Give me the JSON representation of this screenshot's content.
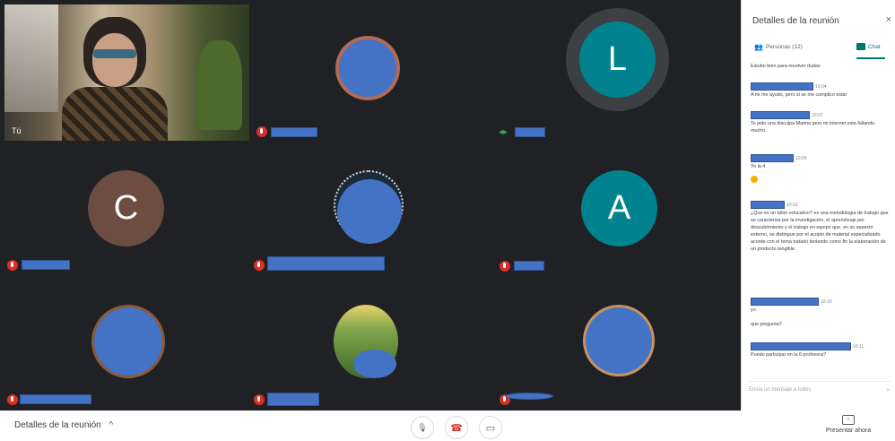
{
  "self_tile": {
    "label": "Tú"
  },
  "letters": {
    "l": "L",
    "c": "C",
    "a": "A"
  },
  "colors": {
    "stage_bg": "#202124",
    "avatar_l": "#00838f",
    "avatar_c": "#6d4c41",
    "avatar_a": "#00838f",
    "accent": "#00796b",
    "mic_off": "#d93025",
    "redaction": "#4472c4"
  },
  "icons": {
    "mic_off": "mic-off-icon",
    "mic_on": "audio-level-icon",
    "people": "people-icon",
    "chat": "chat-icon",
    "close": "close-icon",
    "chevron": "chevron-up-icon",
    "mic": "mic-icon",
    "hangup": "hangup-icon",
    "camera": "camera-icon",
    "present": "present-icon",
    "send": "send-icon"
  },
  "glyphs": {
    "close": "×",
    "chevron": "^",
    "mic": "🎙",
    "hangup": "☎",
    "camera": "▭",
    "present": "↑",
    "send": "➤",
    "mic_on": "◂▸"
  },
  "bottombar": {
    "meeting_details": "Detalles de la reunión",
    "present_now": "Presentar ahora"
  },
  "panel": {
    "title": "Detalles de la reunión",
    "tab_people": "Personas (12)",
    "tab_chat": "Chat",
    "compose_placeholder": "Envía un mensaje a todos",
    "messages": [
      {
        "time": "",
        "text": "Estubo bien para resolver dudas"
      },
      {
        "time": "10:04",
        "text": "A mi me ayudo, pero si se me complico estar"
      },
      {
        "time": "10:07",
        "text": "Te pido una disculpa Marina pero mi internet esta fallando mucho."
      },
      {
        "time": "10:09",
        "text": "Yo la 4"
      },
      {
        "time": "10:10",
        "text": "¿Que es un taller educativo? es una metodologia de trabajo que se caracteriza por la investigación, el aprendizaje por descubrimiento y el trabajo en equipo que, en su aspecto externo, se distingue por el acopio de material especializado acorde con el tema tratado teniendo como fin la elaboración de un producto tangible."
      },
      {
        "time": "10:10",
        "text": "yo"
      },
      {
        "time": "",
        "text": "que pregunta?"
      },
      {
        "time": "10:11",
        "text": "Puedo participar en la 6 profesora?"
      }
    ]
  }
}
